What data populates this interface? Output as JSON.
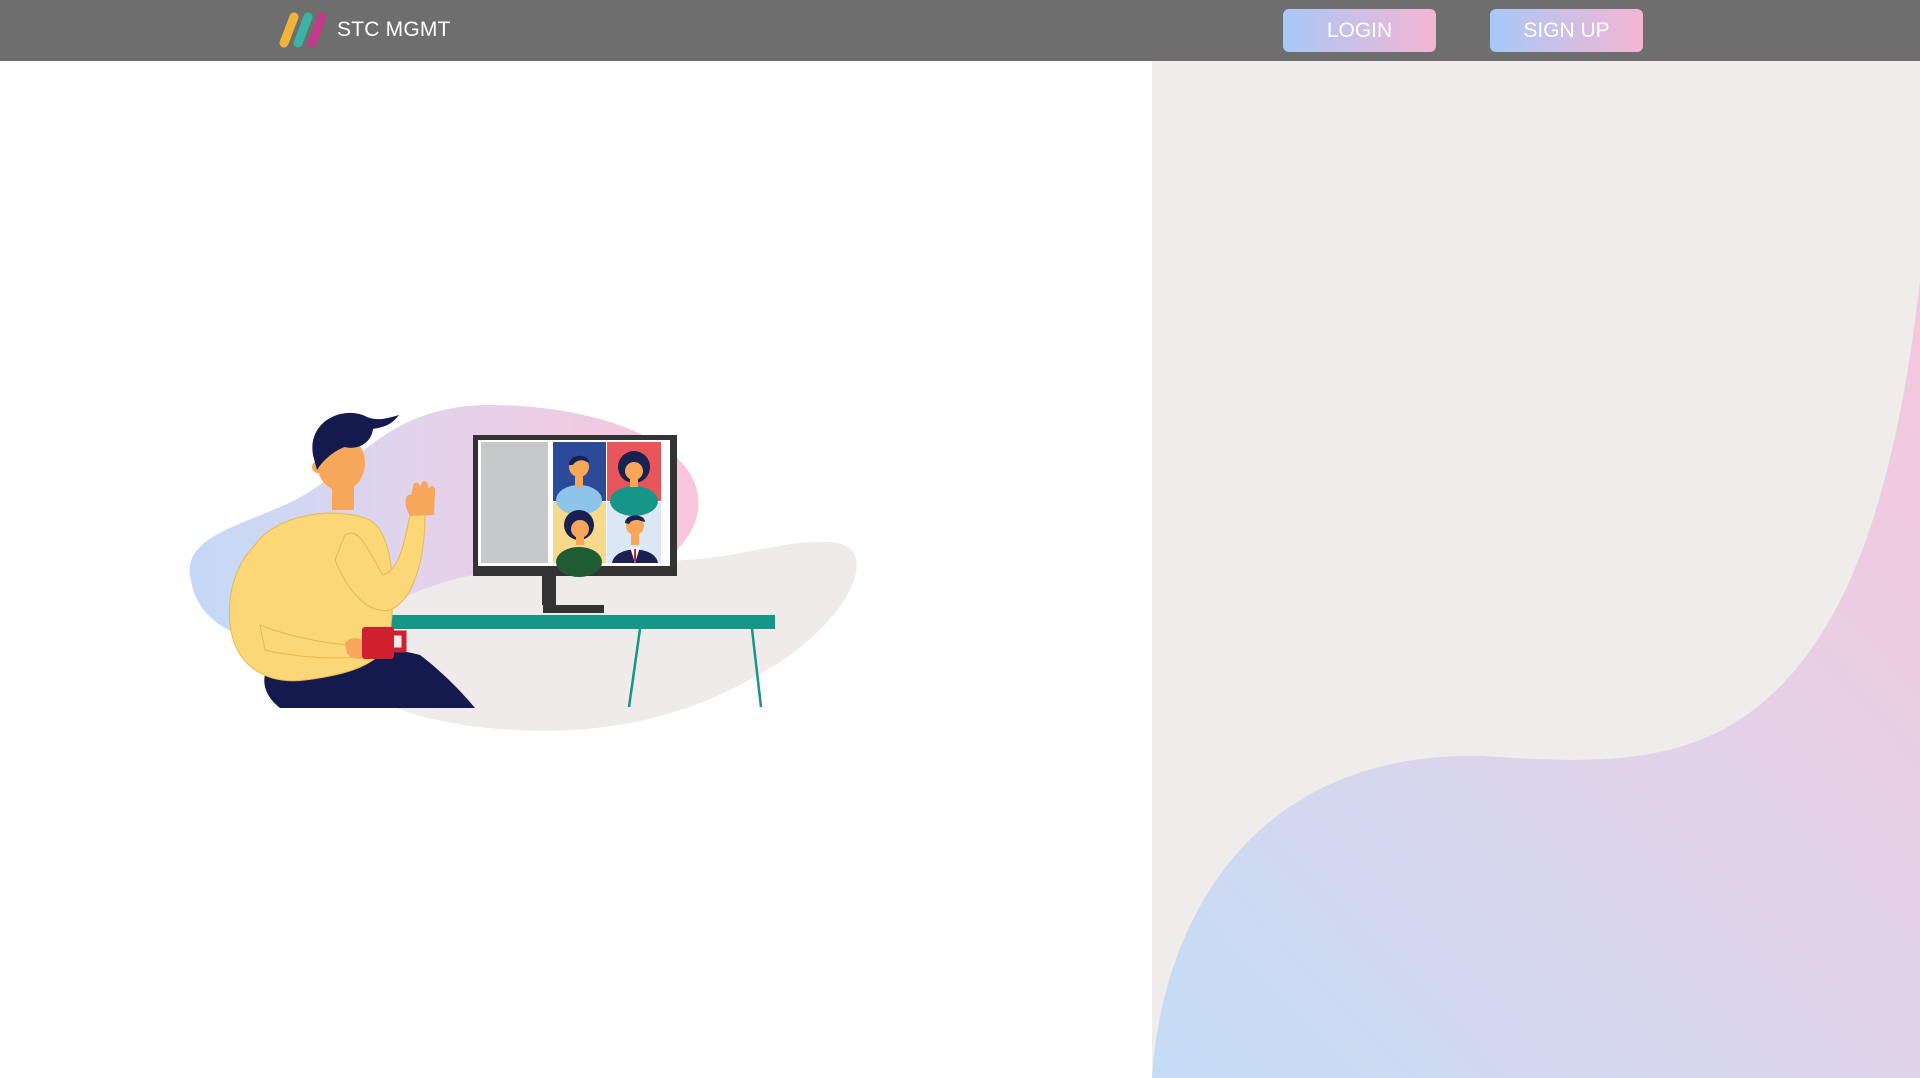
{
  "header": {
    "brand": "STC MGMT",
    "logo_icon": "three-stripes-logo-icon",
    "login_label": "LOGIN",
    "signup_label": "SIGN UP"
  },
  "colors": {
    "topbar": "#6e6e6e",
    "button_gradient_start": "#a8c8f8",
    "button_gradient_end": "#f5b5d2",
    "panel_background": "#f0ecec",
    "logo_stripes": [
      "#f2b33d",
      "#3ab3a3",
      "#c23a8a"
    ]
  },
  "illustration": {
    "icon": "video-conference-illustration-icon"
  }
}
